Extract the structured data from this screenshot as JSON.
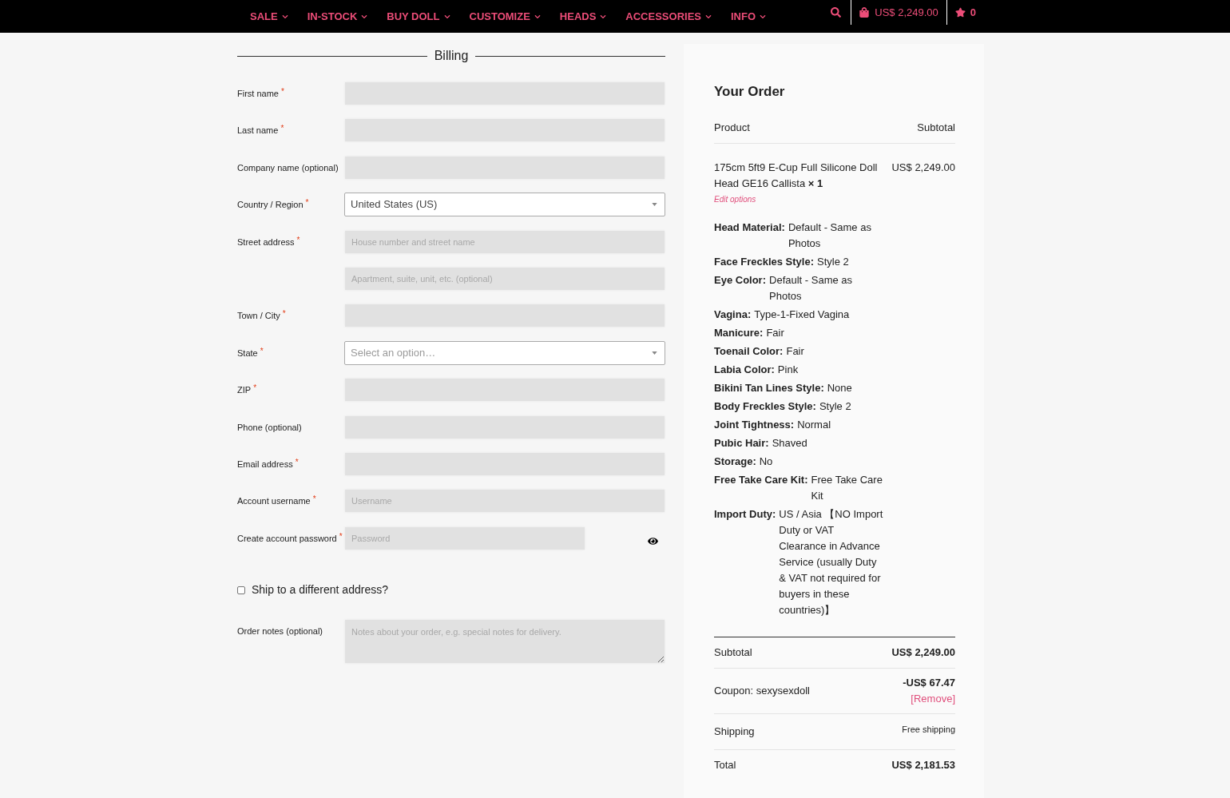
{
  "nav": {
    "items": [
      {
        "label": "SALE",
        "dropdown": true
      },
      {
        "label": "IN-STOCK",
        "dropdown": true
      },
      {
        "label": "BUY DOLL",
        "dropdown": true
      },
      {
        "label": "CUSTOMIZE",
        "dropdown": true
      },
      {
        "label": "HEADS",
        "dropdown": true
      },
      {
        "label": "ACCESSORIES",
        "dropdown": true
      },
      {
        "label": "INFO",
        "dropdown": true
      }
    ],
    "cart": {
      "total": "US$ 2,249.00"
    },
    "wishlist": {
      "count": "0"
    }
  },
  "billing": {
    "title": "Billing",
    "fields": [
      {
        "kind": "text",
        "label": "First name",
        "required_mark": "*"
      },
      {
        "kind": "text",
        "label": "Last name",
        "required_mark": "*"
      },
      {
        "kind": "text",
        "label": "Company name (optional)"
      },
      {
        "kind": "select",
        "label": "Country / Region",
        "required_mark": "*",
        "value": "United States (US)"
      },
      {
        "kind": "text",
        "label": "Street address",
        "required_mark": "*",
        "placeholder": "House number and street name"
      },
      {
        "kind": "text",
        "placeholder": "Apartment, suite, unit, etc. (optional)"
      },
      {
        "kind": "text",
        "label": "Town / City",
        "required_mark": "*"
      },
      {
        "kind": "select",
        "label": "State",
        "required_mark": "*",
        "placeholder": "Select an option…"
      },
      {
        "kind": "text",
        "label": "ZIP",
        "required_mark": "*"
      },
      {
        "kind": "text",
        "label": "Phone (optional)"
      },
      {
        "kind": "text",
        "label": "Email address",
        "required_mark": "*"
      },
      {
        "kind": "text",
        "label": "Account username",
        "required_mark": "*",
        "placeholder": "Username"
      },
      {
        "kind": "password",
        "label": "Create account password",
        "required_mark": "*",
        "placeholder": "Password"
      }
    ],
    "ship_to_different_address": {
      "label": "Ship to a different address?",
      "checked": false
    },
    "order_notes": {
      "label": "Order notes (optional)",
      "placeholder": "Notes about your order, e.g. special notes for delivery."
    }
  },
  "order": {
    "title": "Your Order",
    "columns": [
      "Product",
      "Subtotal"
    ],
    "items": [
      {
        "name": "175cm 5ft9 E-Cup Full Silicone Doll Head GE16 Callista **× 1**",
        "edit_link": "Edit options",
        "subtotal": "US$ 2,249.00",
        "options": [
          {
            "label": "Head Material:",
            "value": "Default - Same as Photos"
          },
          {
            "label": "Face Freckles Style:",
            "value": "Style 2"
          },
          {
            "label": "Eye Color:",
            "value": "Default - Same as Photos"
          },
          {
            "label": "Vagina:",
            "value": "Type-1-Fixed Vagina"
          },
          {
            "label": "Manicure:",
            "value": "Fair"
          },
          {
            "label": "Toenail Color:",
            "value": "Fair"
          },
          {
            "label": "Labia Color:",
            "value": "Pink"
          },
          {
            "label": "Bikini Tan Lines Style:",
            "value": "None"
          },
          {
            "label": "Body Freckles Style:",
            "value": "Style 2"
          },
          {
            "label": "Joint Tightness:",
            "value": "Normal"
          },
          {
            "label": "Pubic Hair:",
            "value": "Shaved"
          },
          {
            "label": "Storage:",
            "value": "No"
          },
          {
            "label": "Free Take Care Kit:",
            "value": "Free Take Care Kit"
          },
          {
            "label": "Import Duty:",
            "value": "US / Asia 【NO Import Duty or VAT Clearance in Advance Service (usually Duty & VAT not required for buyers in these countries)】"
          }
        ]
      }
    ],
    "totals": [
      {
        "kind": "amount",
        "label": "Subtotal",
        "value": "US$ 2,249.00"
      },
      {
        "kind": "discount",
        "label": "Coupon: sexysexdoll",
        "value": "-US$ 67.47",
        "action": "[Remove]"
      },
      {
        "kind": "shipping",
        "label": "Shipping",
        "value": "Free shipping"
      },
      {
        "kind": "amount",
        "label": "Total",
        "value": "US$ 2,181.53"
      }
    ]
  }
}
